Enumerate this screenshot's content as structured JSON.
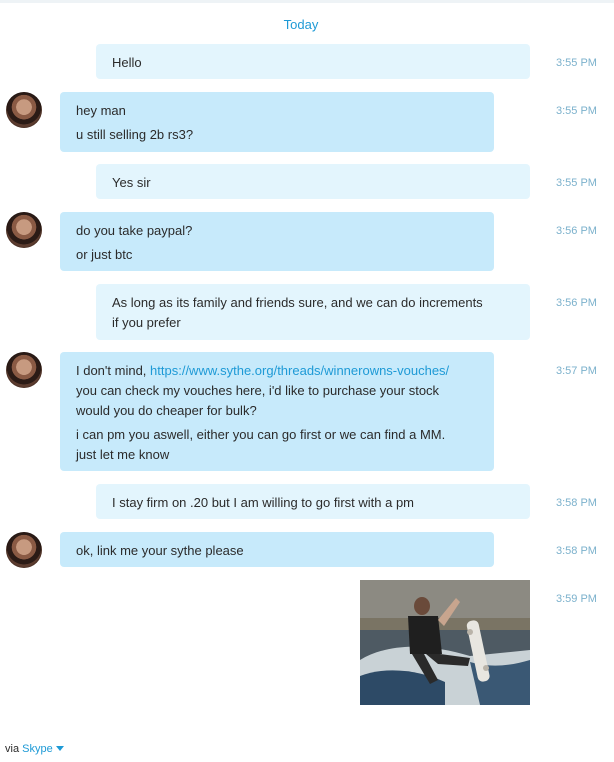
{
  "day_header": "Today",
  "messages": [
    {
      "lines": [
        "Hello"
      ],
      "time": "3:55 PM"
    },
    {
      "lines": [
        "hey man",
        "u still selling 2b rs3?"
      ],
      "time": "3:55 PM"
    },
    {
      "lines": [
        "Yes sir"
      ],
      "time": "3:55 PM"
    },
    {
      "lines": [
        "do you take paypal?",
        "or just btc"
      ],
      "time": "3:56 PM"
    },
    {
      "lines": [
        "As long as its family and friends sure, and we can do increments",
        "if you prefer"
      ],
      "time": "3:56 PM"
    },
    {
      "prefix": "I don't mind, ",
      "link": "https://www.sythe.org/threads/winnerowns-vouches/",
      "lines": [
        "you can check my vouches here, i'd like to purchase your stock",
        "would you do cheaper for bulk?",
        "i can pm you aswell, either you can go first or we can find a MM.",
        "just let me know"
      ],
      "time": "3:57 PM"
    },
    {
      "lines": [
        "I stay firm on .20 but I am willing to go first with a pm"
      ],
      "time": "3:58 PM"
    },
    {
      "lines": [
        "ok, link me your sythe please"
      ],
      "time": "3:58 PM"
    },
    {
      "time": "3:59 PM"
    }
  ],
  "footer": {
    "via": "via",
    "service": "Skype"
  }
}
